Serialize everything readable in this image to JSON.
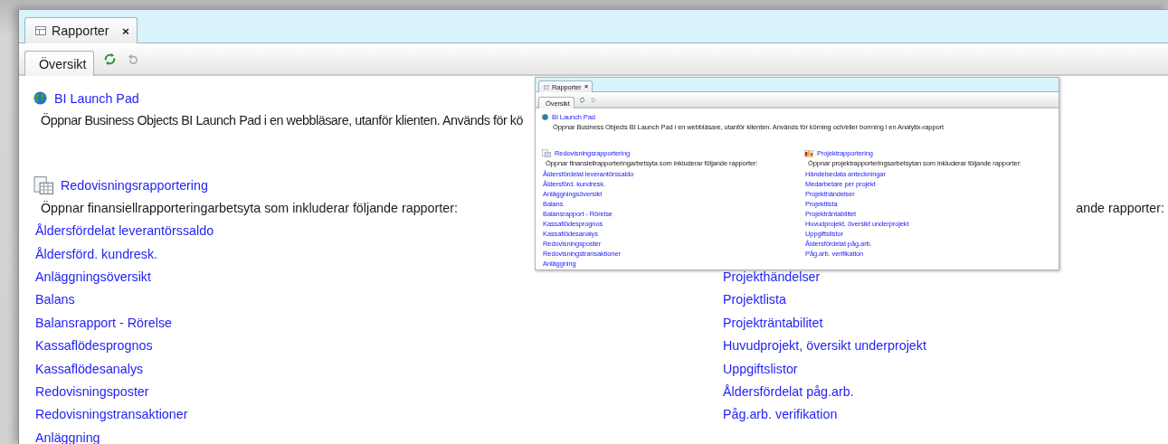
{
  "screen": {
    "tab": {
      "title": "Rapporter",
      "close": "×"
    },
    "subtabs": [
      {
        "label": "Översikt",
        "selected": true
      }
    ],
    "toolbar": [
      {
        "kind": "refresh",
        "disabled": false
      },
      {
        "kind": "undo",
        "disabled": true
      }
    ],
    "launch_pad": {
      "title": "BI Launch Pad",
      "description": "Öppnar Business Objects BI Launch Pad i en webbläsare, utanför klienten. Används för kö"
    },
    "sections": [
      {
        "kind": "finance",
        "title": "Redovisningsrapportering",
        "intro": "Öppnar finansiellrapporteringarbetsyta som inkluderar följande rapporter:",
        "links": [
          "Åldersfördelat leverantörssaldo",
          "Åldersförd. kundresk.",
          "Anläggningsöversikt",
          "Balans",
          "Balansrapport - Rörelse",
          "Kassaflödesprognos",
          "Kassaflödesanalys",
          "Redovisningsposter",
          "Redovisningstransaktioner",
          "Anläggning"
        ]
      },
      {
        "intro": "ande rapporter:",
        "links": [
          "Projekthändelser",
          "Projektlista",
          "Projekträntabilitet",
          "Huvudprojekt, översikt underprojekt",
          "Uppgiftslistor",
          "Åldersfördelat påg.arb.",
          "Påg.arb. verifikation"
        ]
      }
    ]
  },
  "inset_screenshot": {
    "tab": {
      "title": "Rapporter",
      "close": "×"
    },
    "subtabs": [
      {
        "label": "Översikt",
        "selected": true
      }
    ],
    "toolbar": [
      {
        "kind": "refresh",
        "disabled": false
      },
      {
        "kind": "undo",
        "disabled": true
      }
    ],
    "launch_pad": {
      "title": "BI Launch Pad",
      "description": "Öppnar Business Objects BI Launch Pad i en webbläsare, utanför klienten. Används för körning och/eller borrning i en Analytix-rapport"
    },
    "sections": [
      {
        "kind": "finance",
        "title": "Redovisningsrapportering",
        "intro": "Öppnar finansiellrapporteringarbetsyta som inkluderar följande rapporter:",
        "links": [
          "Åldersfördelat leverantörssaldo",
          "Åldersförd. kundresk.",
          "Anläggningsöversikt",
          "Balans",
          "Balansrapport - Rörelse",
          "Kassaflödesprognos",
          "Kassaflödesanalys",
          "Redovisningsposter",
          "Redovisningstransaktioner",
          "Anläggning"
        ]
      },
      {
        "kind": "project",
        "title": "Projektrapportering",
        "intro": "Öppnar projektrapporteringsarbetsytan som inkluderar följande rapporter:",
        "links": [
          "Händelsedata anteckningar",
          "Medarbetare per projekt",
          "Projekthändelser",
          "Projektlista",
          "Projekträntabilitet",
          "Huvudprojekt, översikt underprojekt",
          "Uppgiftslistor",
          "Åldersfördelat påg.arb.",
          "Påg.arb. verifikation"
        ]
      }
    ]
  }
}
